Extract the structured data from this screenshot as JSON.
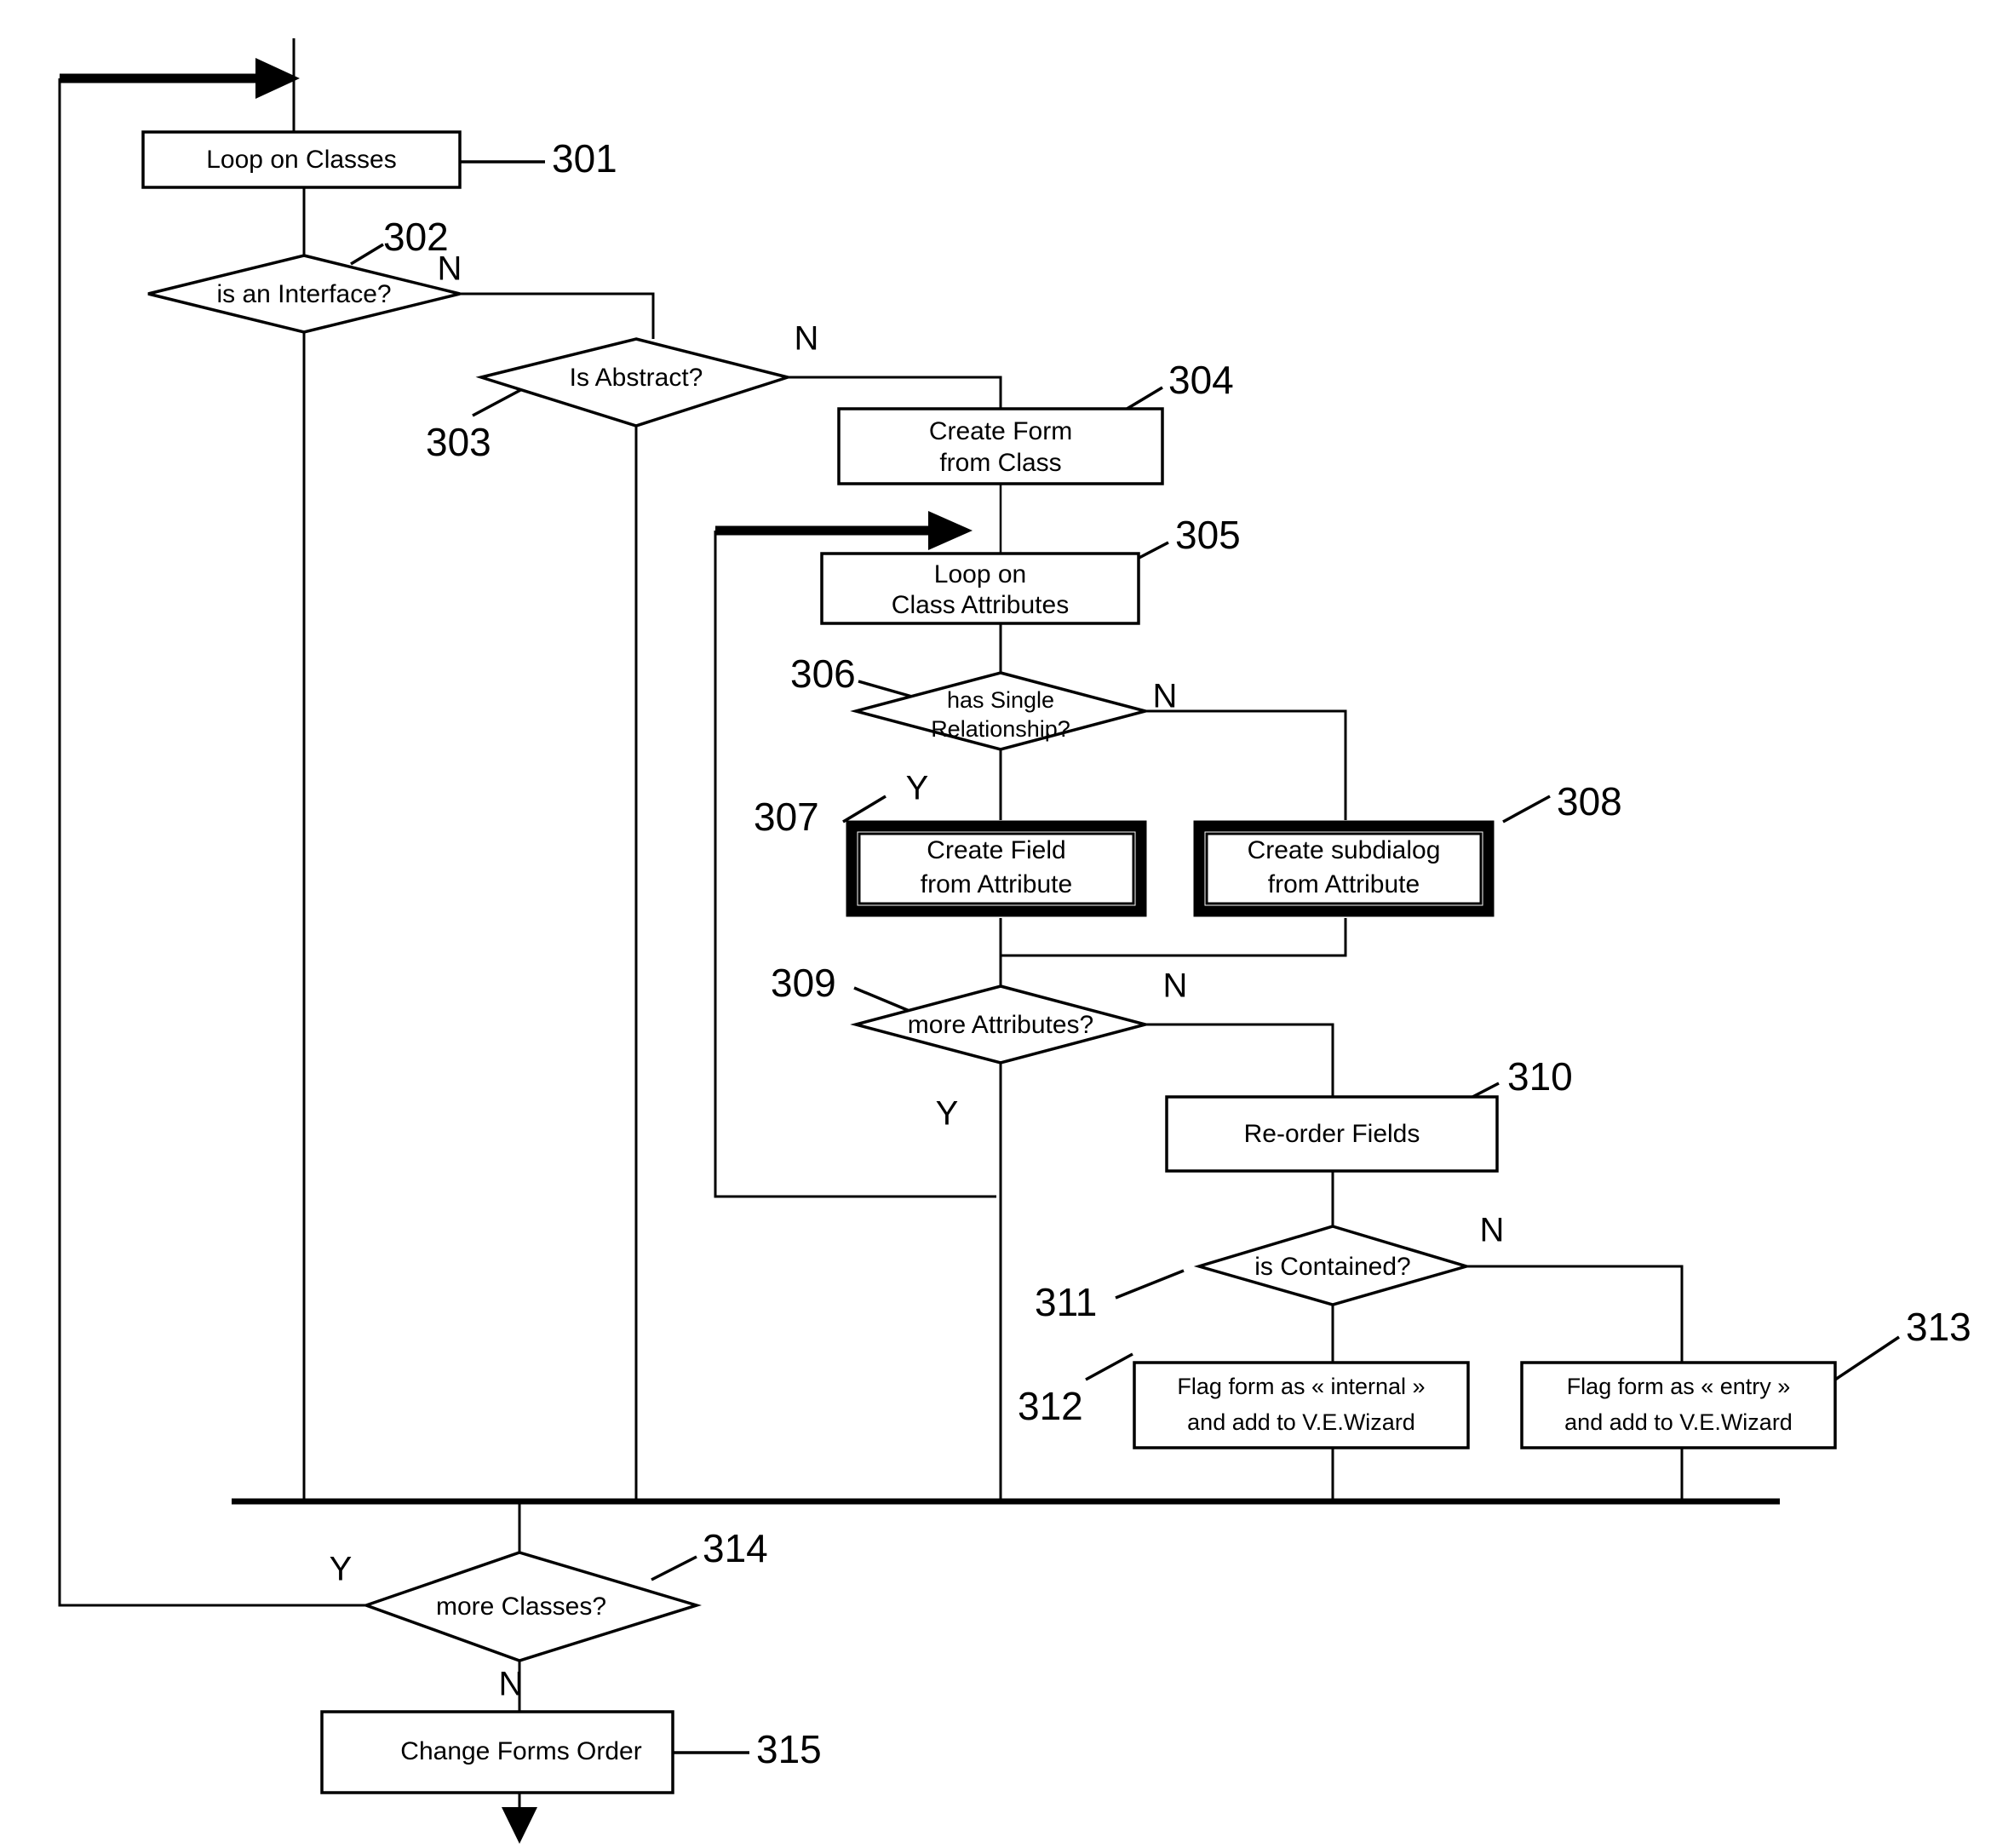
{
  "diagram": {
    "title": "Form generation flowchart",
    "type": "flowchart",
    "background": "#ffffff",
    "line_color": "#000000"
  },
  "nodes": {
    "n301": {
      "ref": "301",
      "shape": "process",
      "line1": "Loop on Classes",
      "line2": ""
    },
    "n302": {
      "ref": "302",
      "shape": "decision",
      "line1": "is an Interface?",
      "line2": ""
    },
    "n303": {
      "ref": "303",
      "shape": "decision",
      "line1": "Is Abstract?",
      "line2": ""
    },
    "n304": {
      "ref": "304",
      "shape": "process",
      "line1": "Create Form",
      "line2": "from Class"
    },
    "n305": {
      "ref": "305",
      "shape": "process",
      "line1": "Loop on",
      "line2": "Class Attributes"
    },
    "n306": {
      "ref": "306",
      "shape": "decision",
      "line1": "has Single",
      "line2": "Relationship?"
    },
    "n307": {
      "ref": "307",
      "shape": "process-bold",
      "line1": "Create Field",
      "line2": "from Attribute"
    },
    "n308": {
      "ref": "308",
      "shape": "process-bold",
      "line1": "Create subdialog",
      "line2": "from Attribute"
    },
    "n309": {
      "ref": "309",
      "shape": "decision",
      "line1": "more Attributes?",
      "line2": ""
    },
    "n310": {
      "ref": "310",
      "shape": "process",
      "line1": "Re-order Fields",
      "line2": ""
    },
    "n311": {
      "ref": "311",
      "shape": "decision",
      "line1": "is Contained?",
      "line2": ""
    },
    "n312": {
      "ref": "312",
      "shape": "process",
      "line1": "Flag form as « internal »",
      "line2": "and add to V.E.Wizard"
    },
    "n313": {
      "ref": "313",
      "shape": "process",
      "line1": "Flag form as « entry »",
      "line2": "and add to V.E.Wizard"
    },
    "n314": {
      "ref": "314",
      "shape": "decision",
      "line1": "more Classes?",
      "line2": ""
    },
    "n315": {
      "ref": "315",
      "shape": "process",
      "line1": "Change Forms Order",
      "line2": ""
    }
  },
  "branch_labels": {
    "b302_n": "N",
    "b303_n": "N",
    "b306_n": "N",
    "b306_y": "Y",
    "b309_n": "N",
    "b309_y": "Y",
    "b311_n": "N",
    "b314_y": "Y",
    "b314_n": "N"
  }
}
